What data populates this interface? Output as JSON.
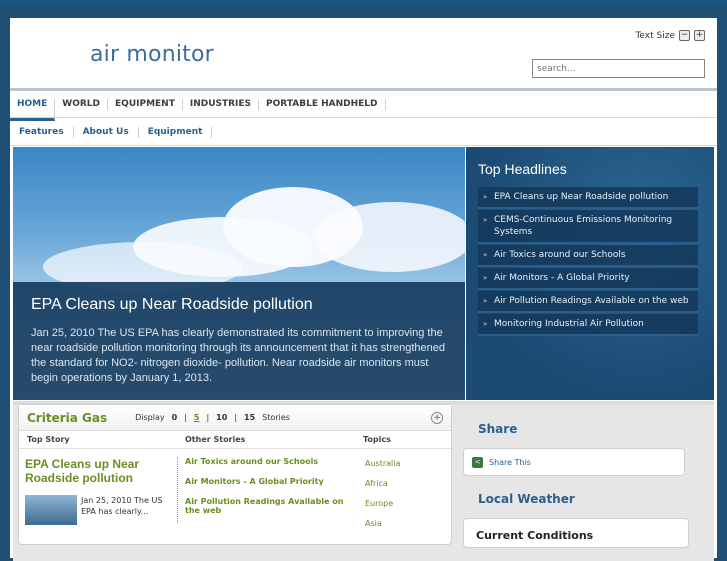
{
  "header": {
    "logo": "air monitor",
    "text_size_label": "Text Size",
    "text_size_minus": "−",
    "text_size_plus": "+",
    "search_placeholder": "search..."
  },
  "nav_main": [
    {
      "label": "HOME",
      "active": true
    },
    {
      "label": "WORLD"
    },
    {
      "label": "EQUIPMENT"
    },
    {
      "label": "INDUSTRIES"
    },
    {
      "label": "PORTABLE HANDHELD"
    }
  ],
  "nav_sub": [
    {
      "label": "Features"
    },
    {
      "label": "About Us"
    },
    {
      "label": "Equipment"
    }
  ],
  "hero": {
    "title": "EPA Cleans up Near Roadside pollution",
    "text": "Jan 25, 2010 The US EPA has clearly demonstrated its commitment to improving the near roadside pollution monitoring through its announcement that it has strengthened the standard for NO2- nitrogen dioxide- pollution. Near roadside air monitors must begin operations by January 1, 2013."
  },
  "headlines": {
    "title": "Top Headlines",
    "items": [
      "EPA Cleans up Near Roadside pollution",
      "CEMS-Continuous Emissions Monitoring Systems",
      "Air Toxics around our Schools",
      "Air Monitors - A Global Priority",
      "Air Pollution Readings Available on the web",
      "Monitoring Industrial Air Pollution"
    ]
  },
  "criteria": {
    "title": "Criteria Gas",
    "display_label": "Display",
    "display_options": [
      "0",
      "5",
      "10",
      "15"
    ],
    "display_selected": "5",
    "stories_label": "Stories",
    "expand_icon": "+",
    "col_top_story": "Top Story",
    "col_other": "Other Stories",
    "col_topics": "Topics",
    "top_story_title": "EPA Cleans up Near Roadside pollution",
    "top_story_text": "Jan 25, 2010 The US EPA has clearly...",
    "other_stories": [
      "Air Toxics around our Schools",
      "Air Monitors - A Global Priority",
      "Air Pollution Readings Available on the web"
    ],
    "topics": [
      "Australia",
      "Africa",
      "Europe",
      "Asia"
    ]
  },
  "sidebar": {
    "share_title": "Share",
    "share_label": "Share This",
    "weather_title": "Local Weather",
    "current_conditions": "Current Conditions"
  }
}
